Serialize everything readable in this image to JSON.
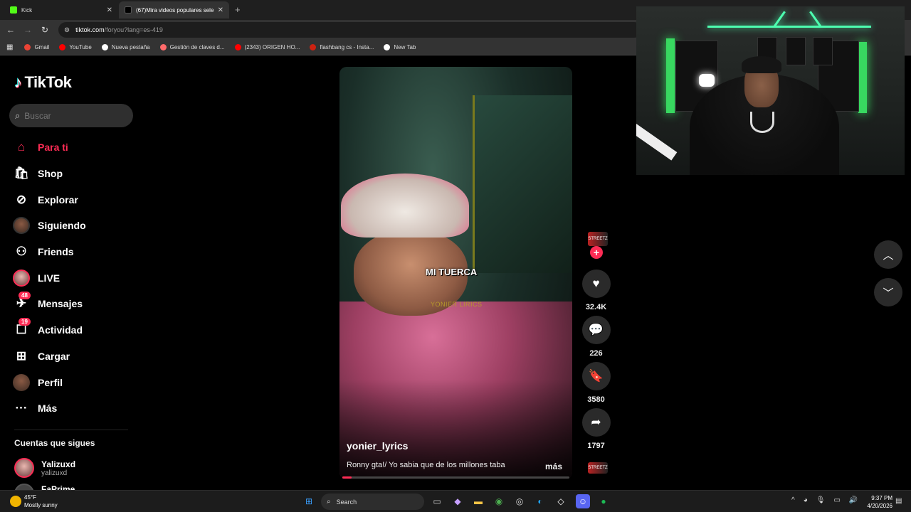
{
  "browser": {
    "tabs": [
      {
        "title": "Kick",
        "color": "#53fc18"
      },
      {
        "title": "(67)Mira videos populares sele",
        "color": "#ffffff"
      }
    ],
    "url_host": "tiktok.com",
    "url_path": "/foryou?lang=es-419",
    "bookmarks": [
      {
        "label": "Gmail",
        "color": "#ea4335"
      },
      {
        "label": "YouTube",
        "color": "#ff0000"
      },
      {
        "label": "Nueva pestaña",
        "color": "#ffffff"
      },
      {
        "label": "Gestión de claves d...",
        "color": "#ff6b6b"
      },
      {
        "label": "(2343) ORIGEN HO...",
        "color": "#ff0000"
      },
      {
        "label": "flashbang cs - Insta...",
        "color": "#c21"
      },
      {
        "label": "New Tab",
        "color": "#ffffff"
      }
    ]
  },
  "tiktok": {
    "brand": "TikTok",
    "search_placeholder": "Buscar",
    "nav": [
      {
        "label": "Para ti",
        "icon": "home-icon",
        "active": true
      },
      {
        "label": "Shop",
        "icon": "shop-icon"
      },
      {
        "label": "Explorar",
        "icon": "compass-icon"
      },
      {
        "label": "Siguiendo",
        "icon": "avatar"
      },
      {
        "label": "Friends",
        "icon": "friends-icon"
      },
      {
        "label": "LIVE",
        "icon": "live-avatar"
      },
      {
        "label": "Mensajes",
        "icon": "messages-icon",
        "badge": "48"
      },
      {
        "label": "Actividad",
        "icon": "activity-icon",
        "badge": "19"
      },
      {
        "label": "Cargar",
        "icon": "upload-icon"
      },
      {
        "label": "Perfil",
        "icon": "profile-avatar"
      },
      {
        "label": "Más",
        "icon": "more-icon"
      }
    ],
    "following_title": "Cuentas que sigues",
    "accounts": [
      {
        "name": "Yalizuxd",
        "handle": "yalizuxd"
      },
      {
        "name": "FaPrime",
        "handle": ""
      }
    ]
  },
  "video": {
    "overlay_text": "MI TUERCA",
    "watermark": "YONIER LIRICS",
    "username": "yonier_lyrics",
    "description": "Ronny gta!/ Yo sabia que de los millones taba",
    "more_label": "más",
    "progress_fraction": 0.04,
    "likes": "32.4K",
    "comments": "226",
    "saves": "3580",
    "shares": "1797",
    "creator_badge": "STREETZ"
  },
  "taskbar": {
    "temp": "45°F",
    "weather": "Mostly sunny",
    "search_label": "Search",
    "time": "9:37 PM",
    "date": "4/20/2026"
  }
}
